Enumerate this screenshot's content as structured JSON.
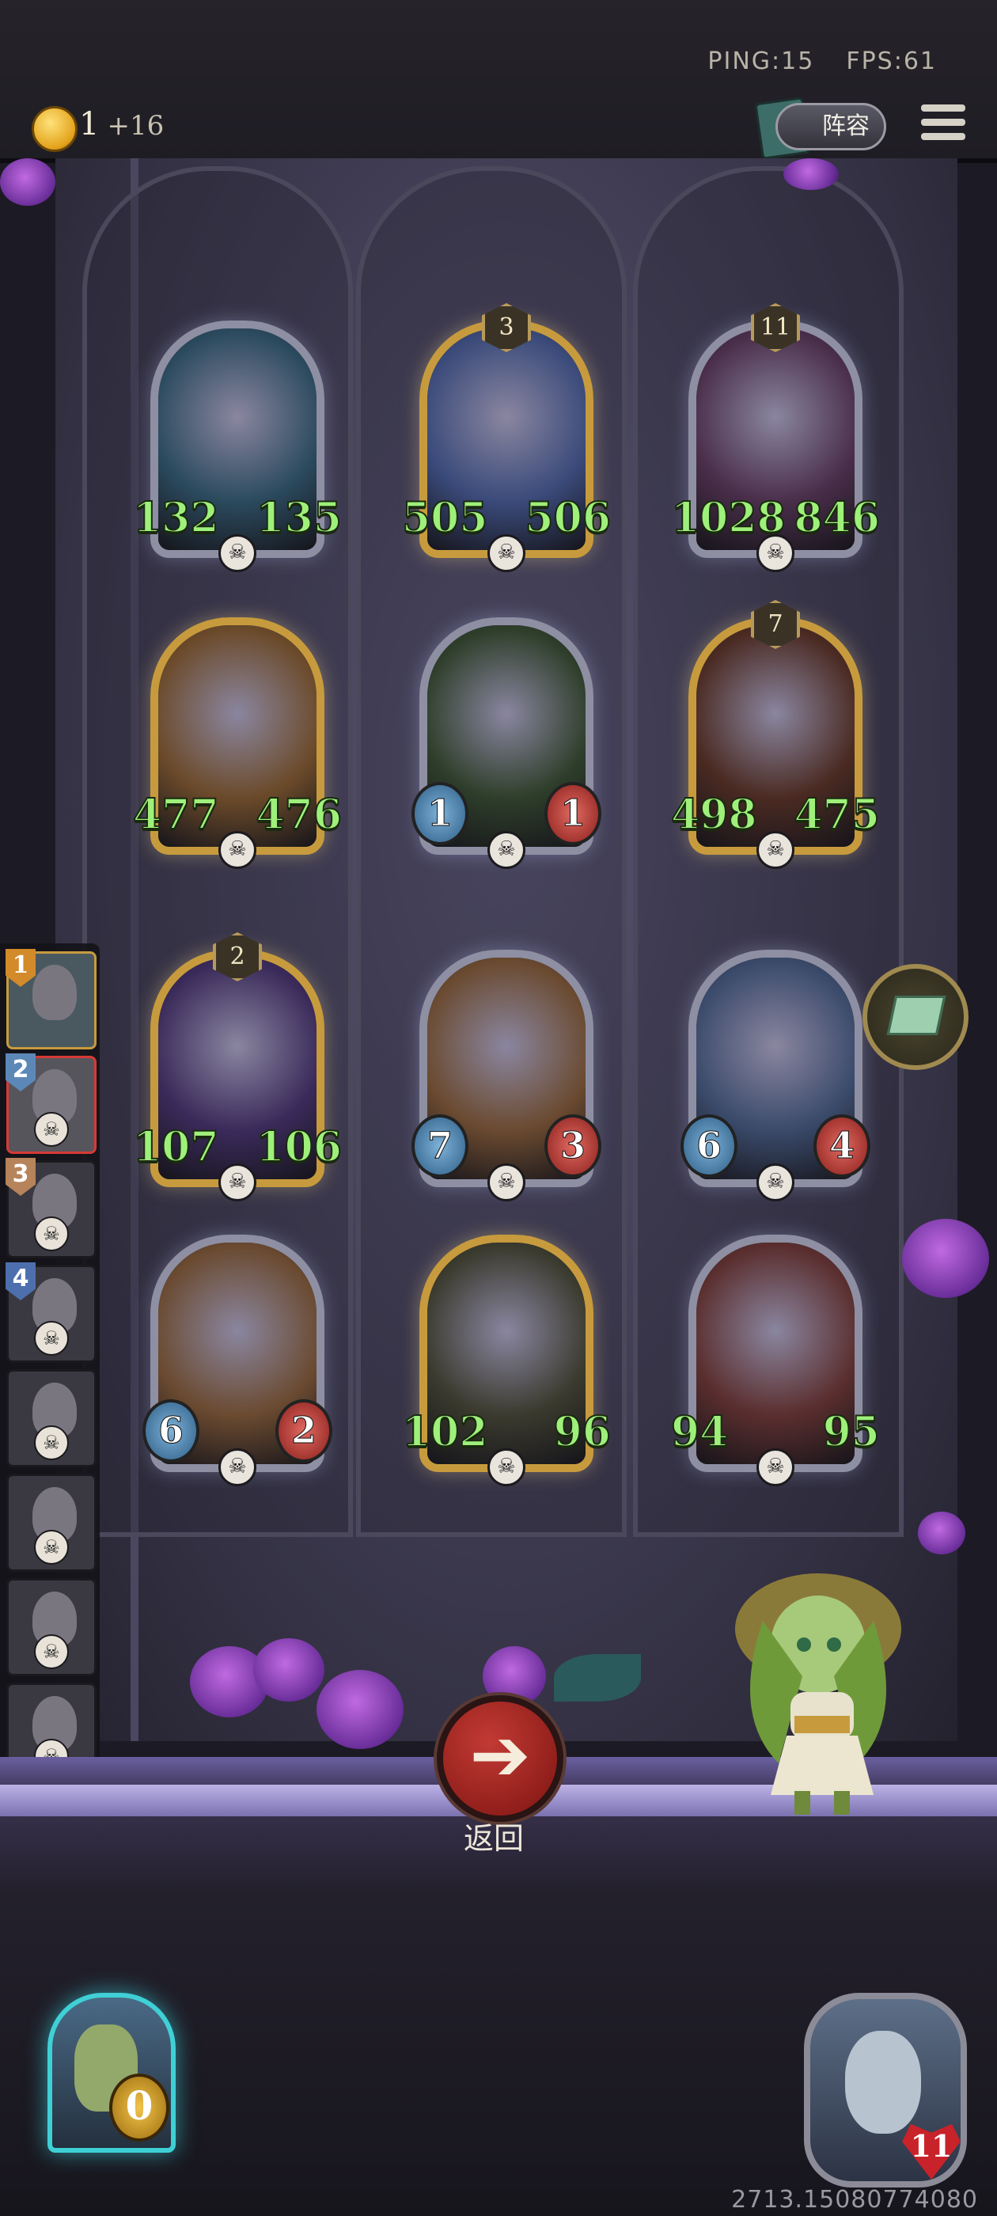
{
  "hud": {
    "ping": "PING:15",
    "fps": "FPS:61",
    "gold": "1",
    "gold_income": "+16",
    "lineup_label": "阵容"
  },
  "board": {
    "units": [
      {
        "id": "vampire",
        "name": "vampire",
        "atk": "132",
        "hp": "135",
        "tier": "",
        "frame": "silver"
      },
      {
        "id": "wizard",
        "name": "wizard",
        "atk": "505",
        "hp": "506",
        "tier": "3",
        "frame": "gold"
      },
      {
        "id": "octopus",
        "name": "octopus",
        "atk": "1028",
        "hp": "846",
        "tier": "11",
        "frame": "silver"
      },
      {
        "id": "scarecrow",
        "name": "scarecrow",
        "atk": "477",
        "hp": "476",
        "tier": "",
        "frame": "gold"
      },
      {
        "id": "witch",
        "name": "witch",
        "atk": "1",
        "hp": "1",
        "tier": "",
        "frame": "silver",
        "orbs": true
      },
      {
        "id": "shield-knight",
        "name": "shield-knight",
        "atk": "498",
        "hp": "475",
        "tier": "7",
        "frame": "gold"
      },
      {
        "id": "clockwork",
        "name": "clockwork",
        "atk": "107",
        "hp": "106",
        "tier": "2",
        "frame": "gold"
      },
      {
        "id": "priest",
        "name": "priest",
        "atk": "7",
        "hp": "3",
        "tier": "",
        "frame": "silver",
        "orbs": "plain"
      },
      {
        "id": "armored-knight",
        "name": "armored-knight",
        "atk": "6",
        "hp": "4",
        "tier": "",
        "frame": "silver",
        "orbs": "plain"
      },
      {
        "id": "priest-2",
        "name": "priest-2",
        "atk": "6",
        "hp": "2",
        "tier": "",
        "frame": "silver",
        "orbs": "plain"
      },
      {
        "id": "gunslinger",
        "name": "gunslinger",
        "atk": "102",
        "hp": "96",
        "tier": "",
        "frame": "gold"
      },
      {
        "id": "pirate",
        "name": "pirate",
        "atk": "94",
        "hp": "95",
        "tier": "",
        "frame": "silver"
      }
    ]
  },
  "roster": {
    "slots": [
      {
        "num": "1",
        "style": "gold",
        "skull": false
      },
      {
        "num": "2",
        "style": "red",
        "skull": true
      },
      {
        "num": "3",
        "style": "plain",
        "skull": true
      },
      {
        "num": "4",
        "style": "plain",
        "skull": true
      },
      {
        "num": "",
        "style": "plain",
        "skull": true
      },
      {
        "num": "",
        "style": "plain",
        "skull": true
      },
      {
        "num": "",
        "style": "plain",
        "skull": true
      },
      {
        "num": "",
        "style": "plain",
        "skull": true
      }
    ]
  },
  "actions": {
    "back_label": "返回",
    "back_icon": "arrow-left-icon"
  },
  "player": {
    "coins": "0"
  },
  "opponent": {
    "hp": "11"
  },
  "footer": {
    "coords": "2713.15080774080"
  },
  "colors": {
    "stat_green": "#9ef07a",
    "gold_frame": "#c79b3d",
    "silver_frame": "#8e8fa3",
    "back_red": "#c33a34",
    "player_glow": "#3fd0d6"
  }
}
